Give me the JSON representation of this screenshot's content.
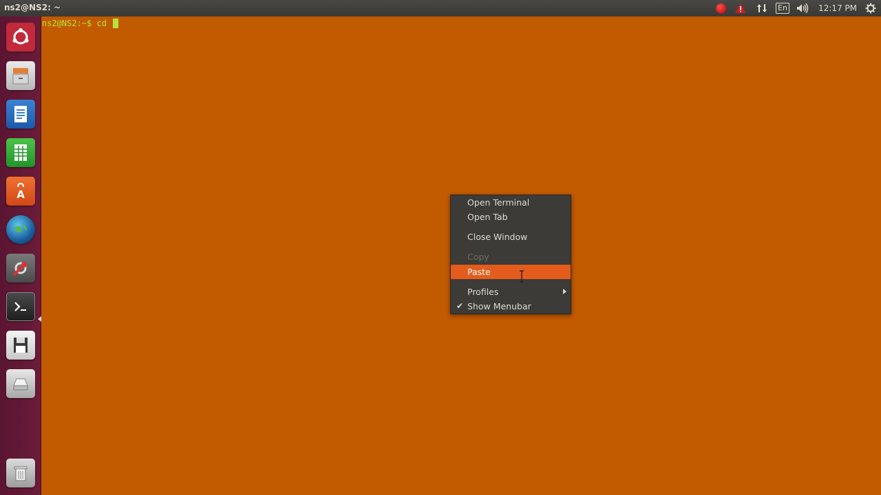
{
  "top_panel": {
    "window_title": "ns2@NS2: ~",
    "keyboard_layout": "En",
    "clock": "12:17 PM",
    "icons": [
      "record-icon",
      "alert-icon",
      "network-icon",
      "keyboard-icon",
      "volume-icon",
      "session-gear-icon"
    ]
  },
  "launcher": {
    "items": [
      {
        "name": "dash-home",
        "icon": "ubuntu-logo-icon"
      },
      {
        "name": "files",
        "icon": "file-cabinet-icon"
      },
      {
        "name": "libreoffice-writer",
        "icon": "writer-document-icon"
      },
      {
        "name": "libreoffice-calc",
        "icon": "spreadsheet-icon"
      },
      {
        "name": "software-center",
        "icon": "shopping-bag-icon"
      },
      {
        "name": "web-browser",
        "icon": "globe-icon"
      },
      {
        "name": "system-settings",
        "icon": "wrench-settings-icon"
      },
      {
        "name": "terminal",
        "icon": "terminal-icon",
        "active": true
      },
      {
        "name": "floppy-drive",
        "icon": "floppy-disk-icon"
      },
      {
        "name": "removable-drive",
        "icon": "drive-icon"
      },
      {
        "name": "trash",
        "icon": "trash-icon"
      }
    ]
  },
  "terminal": {
    "prompt": "ns2@NS2:~$ cd "
  },
  "context_menu": {
    "items": [
      {
        "label": "Open Terminal",
        "enabled": true
      },
      {
        "label": "Open Tab",
        "enabled": true
      },
      {
        "label": "Close Window",
        "enabled": true
      },
      {
        "label": "Copy",
        "enabled": false
      },
      {
        "label": "Paste",
        "enabled": true,
        "selected": true
      },
      {
        "label": "Profiles",
        "enabled": true,
        "submenu": true
      },
      {
        "label": "Show Menubar",
        "enabled": true,
        "checked": true
      }
    ]
  },
  "colors": {
    "terminal_background": "#c25a00",
    "prompt_text": "#b5e53a",
    "menu_background": "#3c3b37",
    "menu_highlight": "#e35c1c",
    "launcher_background": "#5a1532"
  }
}
